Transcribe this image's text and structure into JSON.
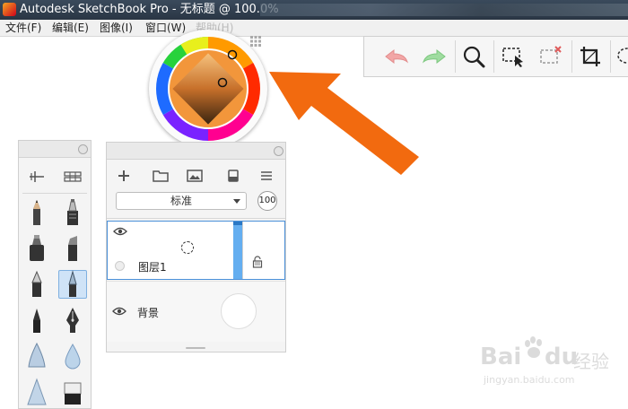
{
  "window": {
    "title": "Autodesk SketchBook Pro - 无标题 @ 100.0%"
  },
  "menu": {
    "items": [
      {
        "label": "文件(F)"
      },
      {
        "label": "编辑(E)"
      },
      {
        "label": "图像(I)"
      },
      {
        "label": "窗口(W)"
      },
      {
        "label": "帮助(H)"
      }
    ]
  },
  "toolbar": {
    "icons": [
      "undo-icon",
      "redo-icon",
      "zoom-icon",
      "select-icon",
      "deselect-icon",
      "crop-icon",
      "lasso-icon"
    ]
  },
  "color_puck": {
    "icon": "color-wheel-icon",
    "hue_color": "#f08a1c",
    "swatch_color": "#e58d3a"
  },
  "brush_palette": {
    "icons": [
      "brush-adjust-icon",
      "brush-library-icon",
      "pencil-icon",
      "airbrush-icon",
      "marker-icon",
      "chisel-marker-icon",
      "pen-icon",
      "ink-pen-icon",
      "fine-brush-icon",
      "fountain-pen-icon",
      "smudge-icon",
      "water-drop-icon",
      "cone-brush-icon",
      "eraser-icon"
    ],
    "selected": "ink-pen-icon"
  },
  "layer_editor": {
    "blend_mode": "标准",
    "opacity": "100",
    "layers": [
      {
        "name": "图层1"
      },
      {
        "name": "背景"
      }
    ]
  },
  "watermark": {
    "brand": "Bai",
    "brand2": "du",
    "cn": "经验",
    "url": "jingyan.baidu.com"
  },
  "colors": {
    "accent_arrow": "#f26a0f",
    "selection_blue": "#4a90d9"
  }
}
